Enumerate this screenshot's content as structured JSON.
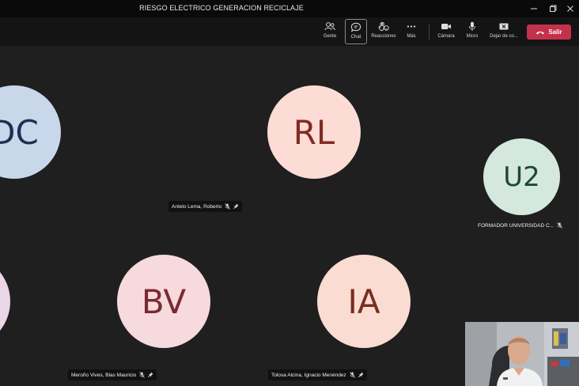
{
  "window": {
    "title": "RIESGO ELECTRICO GENERACION RECICLAJE"
  },
  "toolbar": {
    "people_label": "Gente",
    "chat_label": "Chat",
    "reactions_label": "Reacciones",
    "more_label": "Más",
    "camera_label": "Cámara",
    "mic_label": "Micro",
    "share_label": "Dejar de co...",
    "leave_label": "Salir"
  },
  "participants": [
    {
      "initials": "DC",
      "name": "",
      "bg": "#c9d7ea",
      "fg": "#1d2f53"
    },
    {
      "initials": "RL",
      "name": "Antelo Lema, Roberto",
      "bg": "#fcdcd4",
      "fg": "#7f2c22"
    },
    {
      "initials": "U2",
      "name": "FORMADOR UNIVERSIDAD C...",
      "bg": "#d5e8dd",
      "fg": "#1d4833"
    },
    {
      "initials": "BV",
      "name": "Meroño Vives, Blas Mauricio",
      "bg": "#f7dadd",
      "fg": "#7a2a33"
    },
    {
      "initials": "IA",
      "name": "Tolosa Alcina, Ignacio Menéndez",
      "bg": "#fbdcd2",
      "fg": "#7a2e1e"
    },
    {
      "initials": "",
      "name": "",
      "bg": "#ead6e6",
      "fg": "#5a2a55"
    }
  ],
  "colors": {
    "titlebar": "#0a0a0a",
    "toolbar": "#141414",
    "stage": "#1f1f1f",
    "leave": "#c4314b"
  }
}
